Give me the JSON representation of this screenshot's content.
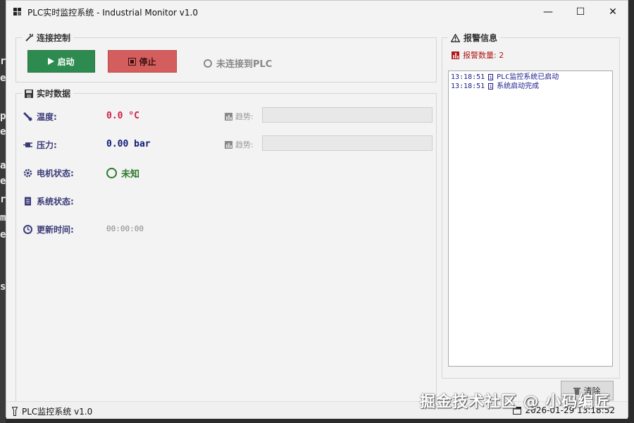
{
  "window": {
    "title": "PLC实时监控系统 - Industrial Monitor v1.0",
    "minimize": "—",
    "maximize": "☐",
    "close": "✕"
  },
  "connection": {
    "group_title": "连接控制",
    "start_label": "启动",
    "stop_label": "停止",
    "status_text": "未连接到PLC"
  },
  "realtime": {
    "group_title": "实时数据",
    "rows": [
      {
        "label": "温度:",
        "value": "0.0 °C",
        "value_color": "#d0214a",
        "trend_label": "趋势:"
      },
      {
        "label": "压力:",
        "value": "0.00 bar",
        "value_color": "#0f1a78",
        "trend_label": "趋势:"
      },
      {
        "label": "电机状态:",
        "value": "未知",
        "value_color": "#2b7a2b"
      },
      {
        "label": "系统状态:",
        "value": ""
      },
      {
        "label": "更新时间:",
        "value": "00:00:00",
        "value_color": "#888888"
      }
    ]
  },
  "alarms": {
    "group_title": "报警信息",
    "count_text": "报警数量: 2",
    "log": [
      {
        "time": "13:18:51",
        "text": "PLC监控系统已启动"
      },
      {
        "time": "13:18:51",
        "text": "系统启动完成"
      }
    ],
    "clear_label": "清除"
  },
  "statusbar": {
    "left_text": "PLC监控系统 v1.0",
    "right_text": "2026-01-29 13:18:52"
  },
  "watermark": "掘金技术社区 @ 小码编匠",
  "background_chars": [
    "r",
    "e",
    "p",
    "e",
    "a",
    "e",
    "r",
    "m",
    "e",
    "s"
  ]
}
